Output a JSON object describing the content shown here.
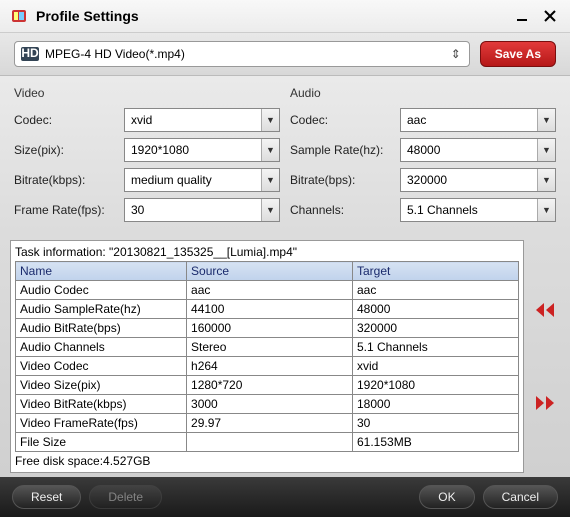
{
  "header": {
    "title": "Profile Settings"
  },
  "toolbar": {
    "profile_value": "MPEG-4 HD Video(*.mp4)",
    "save_as_label": "Save As"
  },
  "video": {
    "section": "Video",
    "codec_label": "Codec:",
    "codec_value": "xvid",
    "size_label": "Size(pix):",
    "size_value": "1920*1080",
    "bitrate_label": "Bitrate(kbps):",
    "bitrate_value": "medium quality",
    "fps_label": "Frame Rate(fps):",
    "fps_value": "30"
  },
  "audio": {
    "section": "Audio",
    "codec_label": "Codec:",
    "codec_value": "aac",
    "sr_label": "Sample Rate(hz):",
    "sr_value": "48000",
    "br_label": "Bitrate(bps):",
    "br_value": "320000",
    "ch_label": "Channels:",
    "ch_value": "5.1 Channels"
  },
  "task": {
    "intro": "Task information: \"20130821_135325__[Lumia].mp4\"",
    "headers": {
      "name": "Name",
      "source": "Source",
      "target": "Target"
    },
    "rows": [
      {
        "name": "Audio Codec",
        "source": "aac",
        "target": "aac"
      },
      {
        "name": "Audio SampleRate(hz)",
        "source": "44100",
        "target": "48000"
      },
      {
        "name": "Audio BitRate(bps)",
        "source": "160000",
        "target": "320000"
      },
      {
        "name": "Audio Channels",
        "source": "Stereo",
        "target": "5.1 Channels"
      },
      {
        "name": "Video Codec",
        "source": "h264",
        "target": "xvid"
      },
      {
        "name": "Video Size(pix)",
        "source": "1280*720",
        "target": "1920*1080"
      },
      {
        "name": "Video BitRate(kbps)",
        "source": "3000",
        "target": "18000"
      },
      {
        "name": "Video FrameRate(fps)",
        "source": "29.97",
        "target": "30"
      },
      {
        "name": "File Size",
        "source": "",
        "target": "61.153MB"
      }
    ],
    "free_space": "Free disk space:4.527GB"
  },
  "footer": {
    "reset": "Reset",
    "delete": "Delete",
    "ok": "OK",
    "cancel": "Cancel"
  }
}
